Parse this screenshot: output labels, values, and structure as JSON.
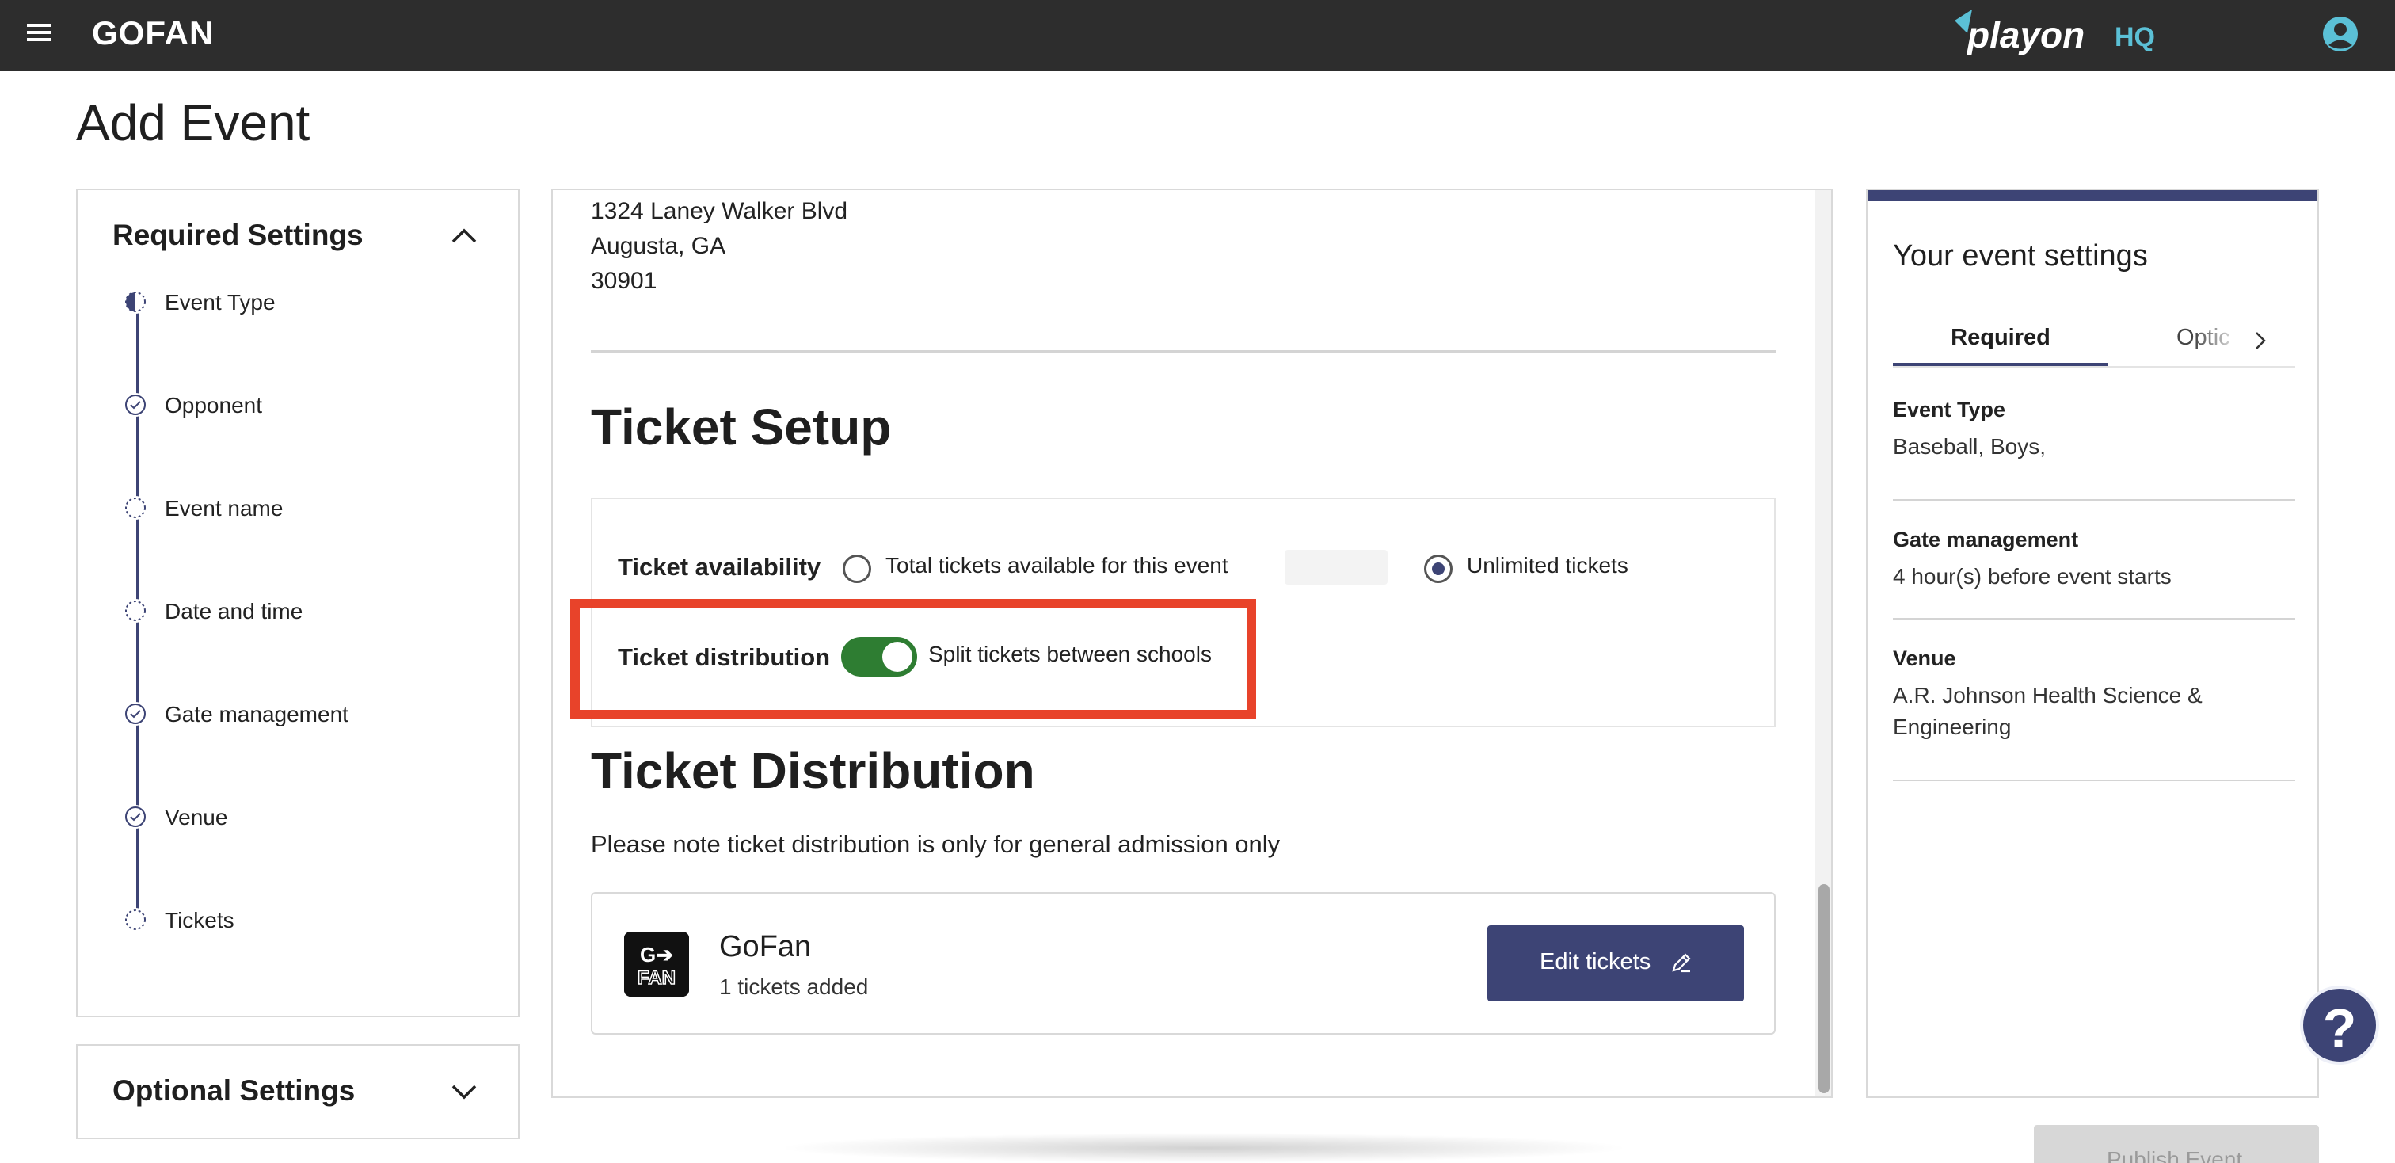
{
  "topbar": {
    "brand": "GOFAN",
    "logo": {
      "text": "playon",
      "suffix": "HQ",
      "accent_color": "#5bc0d6"
    },
    "icons": [
      "menu-icon",
      "account-icon"
    ]
  },
  "page": {
    "title": "Add Event"
  },
  "required_settings": {
    "title": "Required Settings",
    "steps": [
      {
        "label": "Event Type",
        "state": "in-progress"
      },
      {
        "label": "Opponent",
        "state": "complete"
      },
      {
        "label": "Event name",
        "state": "pending"
      },
      {
        "label": "Date and time",
        "state": "pending"
      },
      {
        "label": "Gate management",
        "state": "complete"
      },
      {
        "label": "Venue",
        "state": "complete"
      },
      {
        "label": "Tickets",
        "state": "pending"
      }
    ]
  },
  "optional_settings": {
    "title": "Optional Settings"
  },
  "venue_address": {
    "line1": "1324 Laney Walker Blvd",
    "line2": "Augusta, GA",
    "line3": "30901"
  },
  "ticket_setup": {
    "heading": "Ticket Setup",
    "availability_label": "Ticket availability",
    "option_total": "Total tickets available for this event",
    "option_unlimited": "Unlimited tickets",
    "selected": "unlimited",
    "distribution_label": "Ticket distribution",
    "split_label": "Split tickets between schools",
    "split_enabled": true
  },
  "ticket_distribution": {
    "heading": "Ticket Distribution",
    "note": "Please note ticket distribution is only for general admission only",
    "card": {
      "name": "GoFan",
      "tickets_added": "1 tickets added",
      "edit_label": "Edit tickets"
    }
  },
  "event_settings": {
    "title": "Your event settings",
    "tabs": [
      {
        "label": "Required",
        "active": true
      },
      {
        "label": "Optic",
        "active": false
      }
    ],
    "sections": [
      {
        "heading": "Event Type",
        "value": "Baseball, Boys,"
      },
      {
        "heading": "Gate management",
        "value": "4 hour(s) before event starts"
      },
      {
        "heading": "Venue",
        "value": "A.R. Johnson Health Science & Engineering"
      }
    ]
  },
  "help": {
    "label": "?"
  },
  "publish": {
    "label": "Publish Event"
  },
  "colors": {
    "topbar": "#2d2d2d",
    "primary": "#3d4475",
    "toggle_on": "#2e7d32",
    "highlight": "#e8432a"
  }
}
